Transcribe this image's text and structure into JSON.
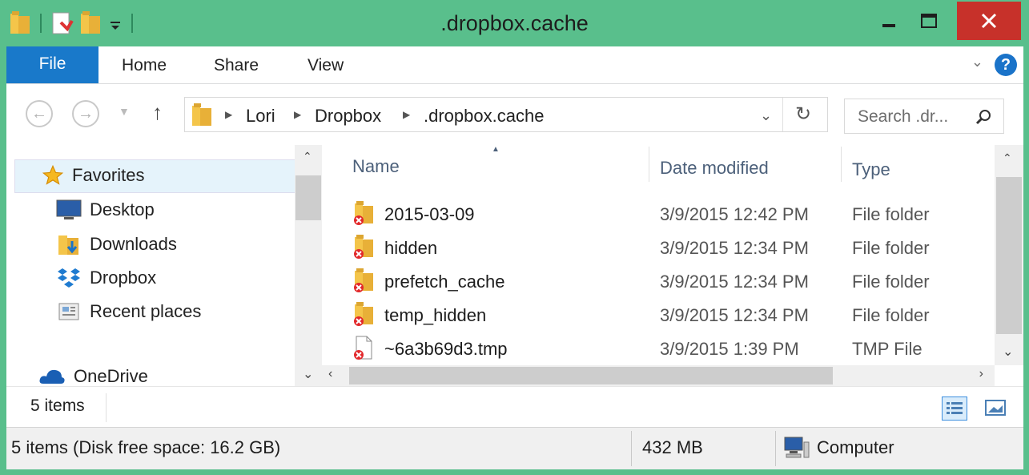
{
  "window": {
    "title": ".dropbox.cache"
  },
  "ribbon": {
    "tabs": [
      {
        "label": "File"
      },
      {
        "label": "Home"
      },
      {
        "label": "Share"
      },
      {
        "label": "View"
      }
    ]
  },
  "address": {
    "crumbs": [
      "Lori",
      "Dropbox",
      ".dropbox.cache"
    ],
    "search_placeholder": "Search .dr..."
  },
  "nav": {
    "favorites_label": "Favorites",
    "items": [
      {
        "label": "Desktop",
        "icon": "desktop-icon"
      },
      {
        "label": "Downloads",
        "icon": "downloads-icon"
      },
      {
        "label": "Dropbox",
        "icon": "dropbox-icon"
      },
      {
        "label": "Recent places",
        "icon": "recent-places-icon"
      }
    ],
    "onedrive_label": "OneDrive"
  },
  "columns": {
    "name": "Name",
    "date": "Date modified",
    "type": "Type"
  },
  "files": [
    {
      "name": "2015-03-09",
      "date": "3/9/2015 12:42 PM",
      "type": "File folder",
      "icon": "folder-sync-error-icon"
    },
    {
      "name": "hidden",
      "date": "3/9/2015 12:34 PM",
      "type": "File folder",
      "icon": "folder-sync-error-icon"
    },
    {
      "name": "prefetch_cache",
      "date": "3/9/2015 12:34 PM",
      "type": "File folder",
      "icon": "folder-sync-error-icon"
    },
    {
      "name": "temp_hidden",
      "date": "3/9/2015 12:34 PM",
      "type": "File folder",
      "icon": "folder-sync-error-icon"
    },
    {
      "name": "~6a3b69d3.tmp",
      "date": "3/9/2015 1:39 PM",
      "type": "TMP File",
      "icon": "file-sync-error-icon"
    }
  ],
  "count": {
    "label": "5 items"
  },
  "status": {
    "items_free": "5 items (Disk free space: 16.2 GB)",
    "size": "432 MB",
    "location": "Computer"
  },
  "colors": {
    "window_frame": "#59bf8c",
    "file_tab": "#1979ca",
    "close_button": "#c7312a",
    "selection": "#e5f3fb"
  }
}
